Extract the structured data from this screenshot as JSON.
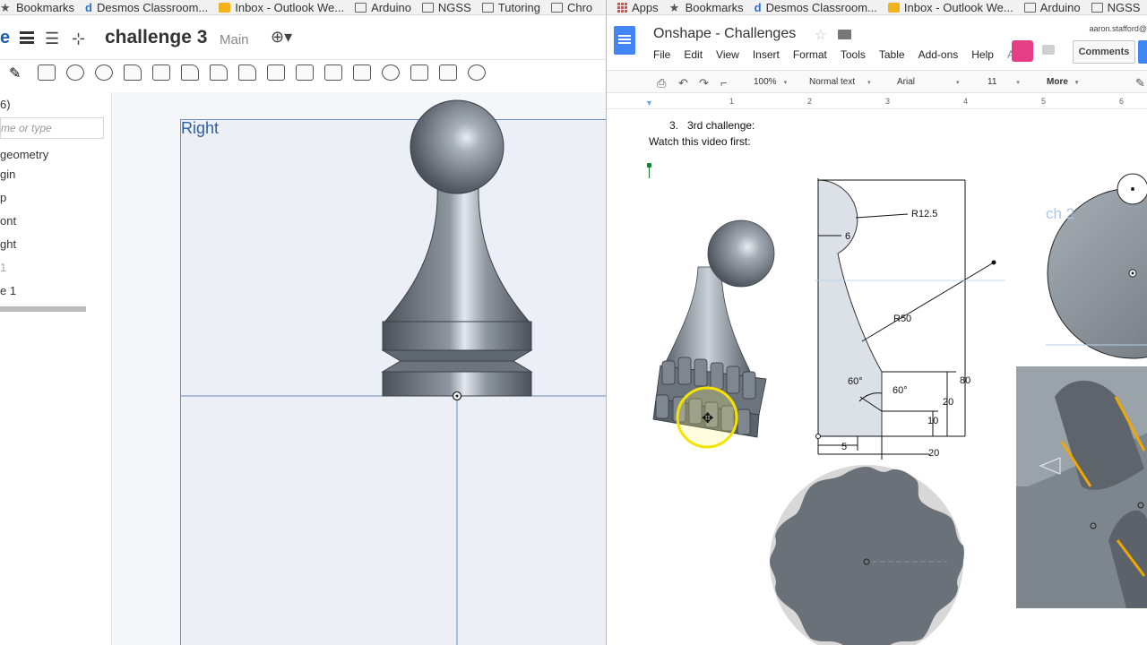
{
  "left_window": {
    "bookmarks": [
      {
        "icon": "star-icon",
        "label": "Bookmarks"
      },
      {
        "icon": "desmos-icon",
        "label": "Desmos Classroom..."
      },
      {
        "icon": "outlook-icon",
        "label": "Inbox - Outlook We..."
      },
      {
        "icon": "folder-icon",
        "label": "Arduino"
      },
      {
        "icon": "folder-icon",
        "label": "NGSS"
      },
      {
        "icon": "folder-icon",
        "label": "Tutoring"
      },
      {
        "icon": "folder-icon",
        "label": "Chro"
      }
    ],
    "logo_fragment": "e",
    "document_title": "challenge 3",
    "branch": "Main",
    "feature_list": {
      "count_fragment": "6)",
      "filter_placeholder": "me or type",
      "items": [
        "geometry",
        "gin",
        "p",
        "ont",
        "ght",
        "1",
        "e 1"
      ]
    },
    "viewport": {
      "plane_label": "Right"
    }
  },
  "right_window": {
    "bookmarks": [
      {
        "icon": "apps-icon",
        "label": "Apps"
      },
      {
        "icon": "star-icon",
        "label": "Bookmarks"
      },
      {
        "icon": "desmos-icon",
        "label": "Desmos Classroom..."
      },
      {
        "icon": "outlook-icon",
        "label": "Inbox - Outlook We..."
      },
      {
        "icon": "folder-icon",
        "label": "Arduino"
      },
      {
        "icon": "folder-icon",
        "label": "NGSS"
      }
    ],
    "doc_title": "Onshape - Challenges",
    "user_email": "aaron.stafford@",
    "menu": [
      "File",
      "Edit",
      "View",
      "Insert",
      "Format",
      "Tools",
      "Table",
      "Add-ons",
      "Help"
    ],
    "menu_overflow": "All",
    "comments_label": "Comments",
    "toolbar": {
      "zoom": "100%",
      "style": "Normal text",
      "font": "Arial",
      "size": "11",
      "more": "More"
    },
    "ruler_numbers": [
      "1",
      "2",
      "3",
      "4",
      "5",
      "6"
    ],
    "content": {
      "list_number": "3.",
      "list_text": "3rd challenge:",
      "instruction": "Watch this video first:"
    },
    "drawing_labels": {
      "r_top": "R12.5",
      "dim_6": "6",
      "r_mid": "R50",
      "angle_a": "60°",
      "angle_b": "60°",
      "dim_80": "80",
      "dim_20_v": "20",
      "dim_10": "10",
      "dim_5": "5",
      "dim_20_h": "20",
      "sketch_label": "ch 2"
    }
  },
  "colors": {
    "onshape_blue": "#1a5fb4",
    "plane_blue": "#6a8cc0",
    "docs_blue": "#4285f4",
    "highlight_yellow": "#f5e400"
  }
}
